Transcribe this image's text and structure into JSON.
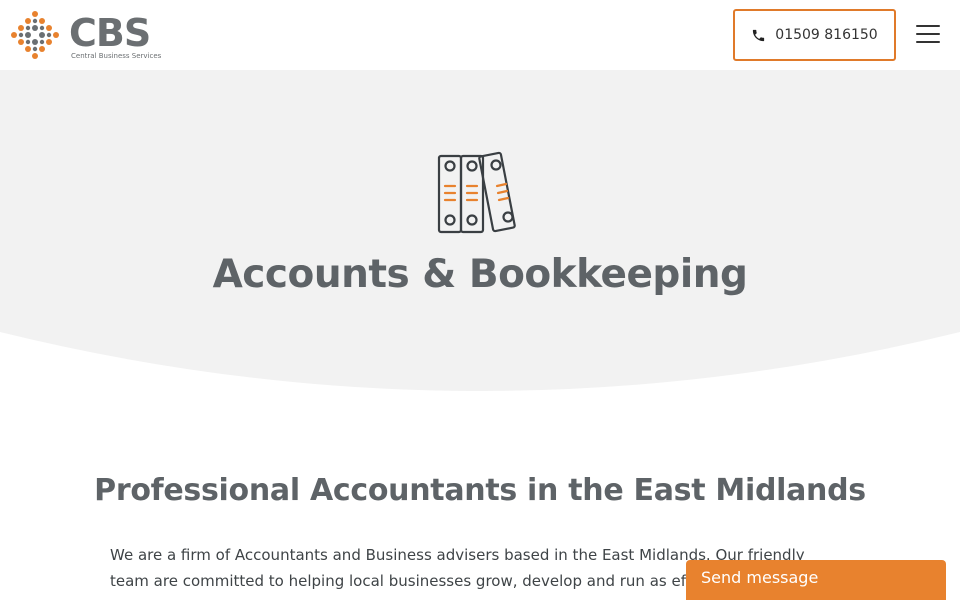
{
  "header": {
    "logo_text": "CBS",
    "logo_tagline": "Central Business Services",
    "phone_label": "01509 816150",
    "phone_icon": "phone-icon",
    "menu_icon": "hamburger-menu-icon"
  },
  "hero": {
    "icon": "binders-icon",
    "title": "Accounts & Bookkeeping",
    "background_color": "#f2f2f2"
  },
  "main": {
    "heading": "Professional Accountants in the East Midlands",
    "intro_line_1": "We are a firm of Accountants and Business advisers based in the East Midlands. Our friendly",
    "intro_line_2": "team are committed to helping local businesses grow, develop and run as eff"
  },
  "chat": {
    "label": "Send message"
  },
  "colors": {
    "accent": "#e8822e",
    "text": "#5e6367"
  }
}
